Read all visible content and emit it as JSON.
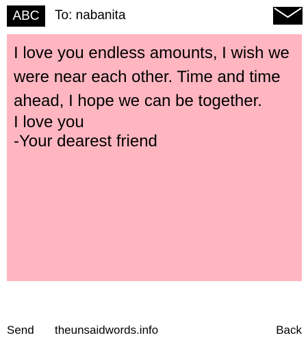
{
  "header": {
    "badge_label": "ABC",
    "recipient_text": "To: nabanita",
    "mail_icon": "envelope-icon"
  },
  "message": {
    "body": "I love you endless amounts, I wish we were near each other. Time and time ahead, I hope we can be together.",
    "closing": "I love you",
    "signature": "-Your dearest friend",
    "background_color": "#ffb6c1"
  },
  "footer": {
    "send_label": "Send",
    "site_label": "theunsaidwords.info",
    "back_label": "Back"
  }
}
